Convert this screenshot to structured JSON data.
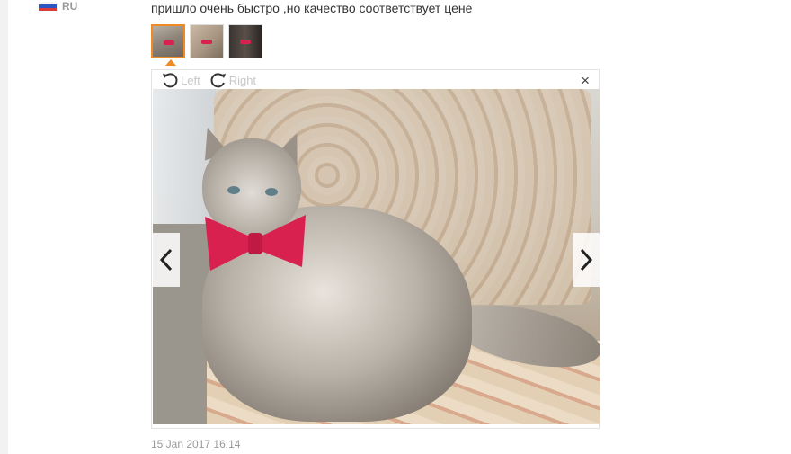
{
  "review": {
    "country_code": "RU",
    "text": "пришло очень быстро ,но качество соответствует цене",
    "date": "15 Jan 2017 16:14"
  },
  "thumbnails": [
    {
      "name": "photo-1",
      "selected": true
    },
    {
      "name": "photo-2",
      "selected": false
    },
    {
      "name": "photo-3",
      "selected": false
    }
  ],
  "viewer": {
    "rotate_left_label": "Left",
    "rotate_right_label": "Right",
    "close_label": "×"
  },
  "icons": {
    "rotate_left": "rotate-left-icon",
    "rotate_right": "rotate-right-icon",
    "prev": "chevron-left-icon",
    "next": "chevron-right-icon",
    "close": "close-icon"
  },
  "colors": {
    "accent": "#f08a24",
    "muted_text": "#999999",
    "bow": "#d8214f"
  }
}
